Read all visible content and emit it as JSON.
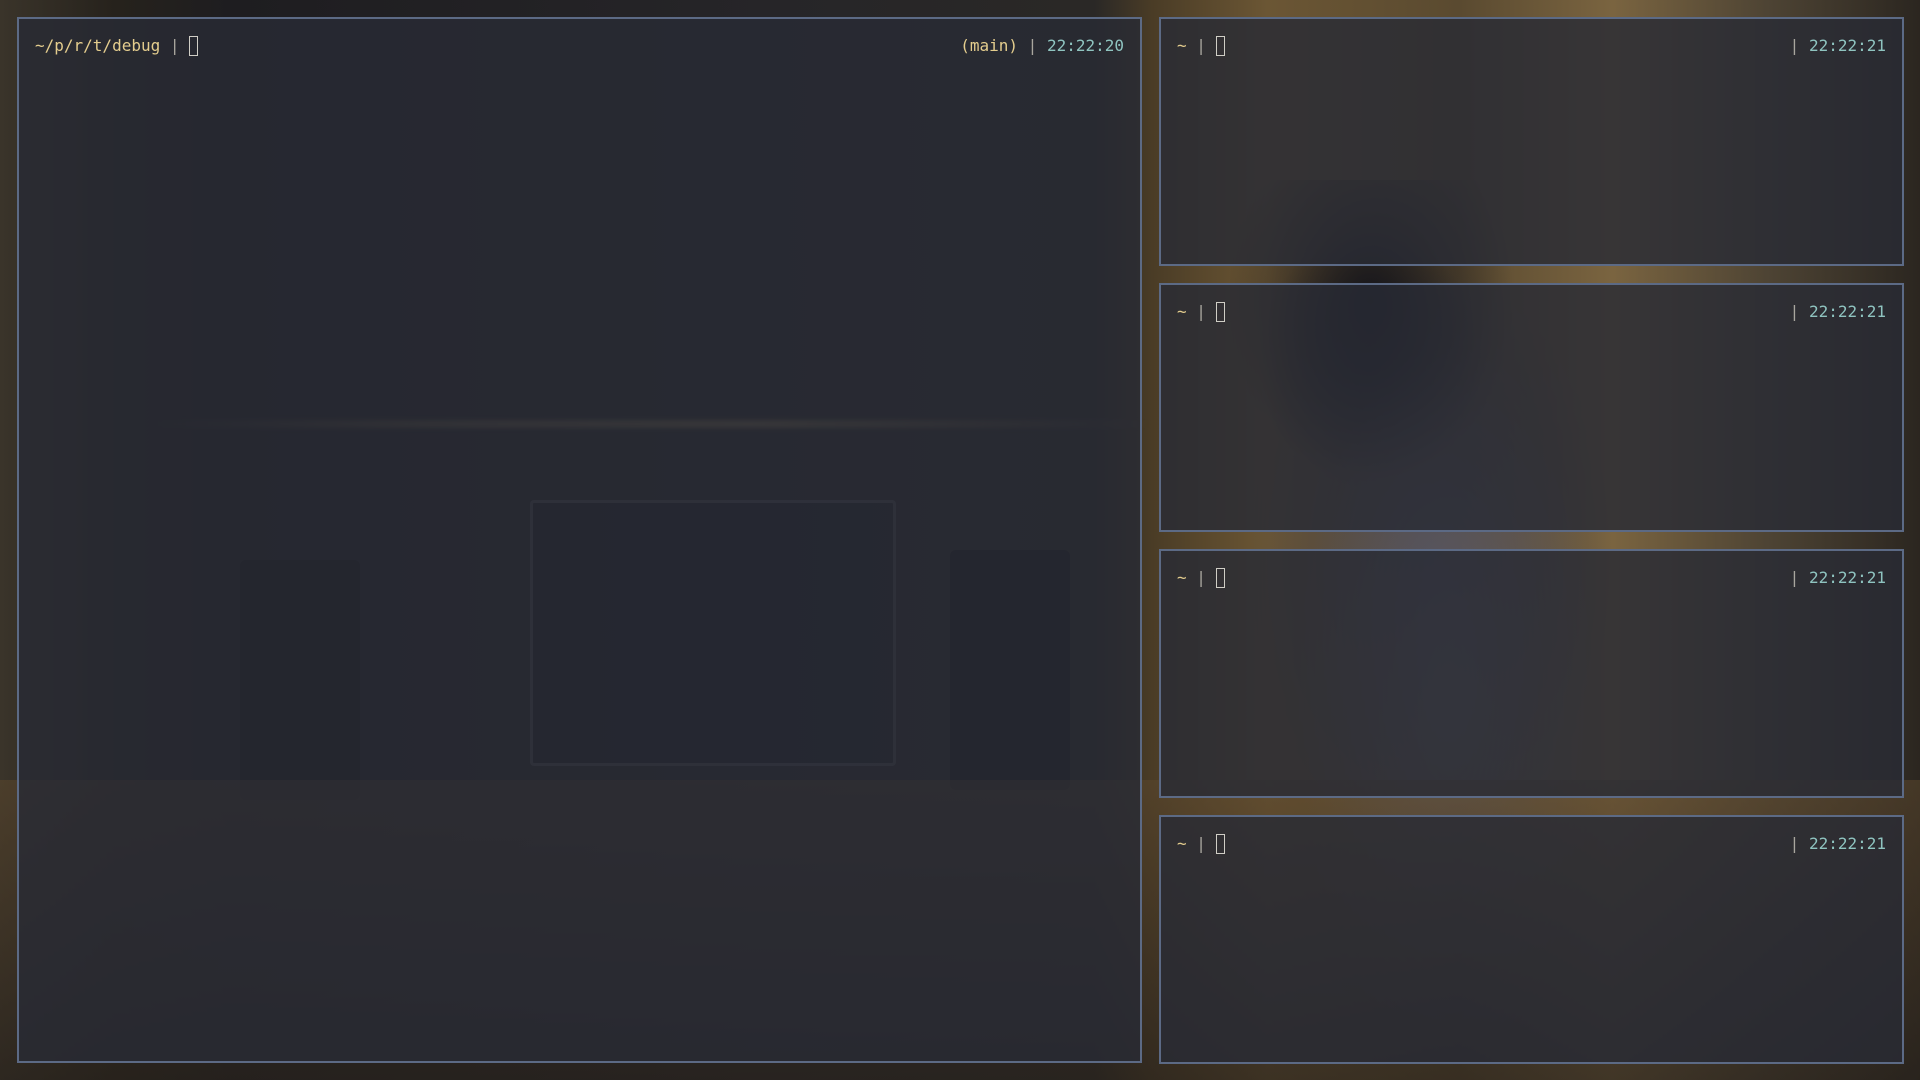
{
  "panes": [
    {
      "id": "main",
      "path": "~/p/r/t/debug",
      "separator": " | ",
      "branch": "(main)",
      "right_separator": " | ",
      "time": "22:22:20"
    },
    {
      "id": "pane-1",
      "path": "~",
      "separator": " | ",
      "right_separator": "| ",
      "time": "22:22:21"
    },
    {
      "id": "pane-2",
      "path": "~",
      "separator": " | ",
      "right_separator": "| ",
      "time": "22:22:21"
    },
    {
      "id": "pane-3",
      "path": "~",
      "separator": " | ",
      "right_separator": "| ",
      "time": "22:22:21"
    },
    {
      "id": "pane-4",
      "path": "~",
      "separator": " | ",
      "right_separator": "| ",
      "time": "22:22:21"
    }
  ],
  "colors": {
    "pane_border": "#5c6a85",
    "pane_background": "#282b34",
    "path": "#e4cd8e",
    "time": "#8fc4c0",
    "separator": "#a9a69e"
  },
  "icons": {
    "cursor": "block-cursor-outline"
  }
}
